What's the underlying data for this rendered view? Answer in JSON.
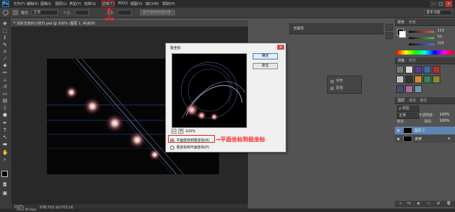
{
  "app": {
    "logo": "Ps"
  },
  "menu": {
    "items": [
      "文件(F)",
      "编辑(E)",
      "图像(I)",
      "图层(L)",
      "类型(Y)",
      "选择(S)",
      "滤镜(T)",
      "3D(D)",
      "视图(V)",
      "窗口(W)",
      "帮助(H)"
    ],
    "highlighted": "滤镜(T)",
    "window_buttons": [
      "–",
      "□",
      "×"
    ]
  },
  "options_bar": {
    "mode_label": "模式:",
    "mode_value": "正常",
    "opacity_label": "不透:",
    "flow_label": "流量:",
    "button_label": "画于使用新建的度",
    "workspace": "基本功能"
  },
  "annotation": {
    "menu_callout": "滤镜",
    "radio_callout": "→平面坐标到极坐标"
  },
  "document": {
    "tab_title": "炫彩光效的小技巧.psd @ 100% (图层 1, RGB/8)",
    "status_text": "文档:703.1K/703.1K",
    "bottom_label": "Mini Bridge"
  },
  "dialog": {
    "title": "极坐标",
    "ok_label": "确定",
    "cancel_label": "复位",
    "zoom_value": "100%",
    "zoom_out": "−",
    "zoom_in": "+",
    "options": [
      {
        "label": "平面坐标到极坐标(R)",
        "selected": true
      },
      {
        "label": "极坐标到平面坐标(P)",
        "selected": false
      }
    ]
  },
  "properties_panel": {
    "title": "无属性",
    "mini_items": [
      "字符",
      "段落"
    ]
  },
  "color_panel": {
    "tabs": [
      "颜色",
      "色板"
    ],
    "values": [
      "115",
      "53",
      "225"
    ],
    "colors": {
      "r": "#e35b5b",
      "g": "#4fc04f",
      "b": "#4a78e0"
    }
  },
  "adjust_panel": {
    "tabs": [
      "调整",
      "样式"
    ]
  },
  "layers_panel": {
    "tabs": [
      "图层",
      "通道",
      "路径"
    ],
    "kind_label": "ρ 类型",
    "blend_mode": "正常",
    "opacity_label": "不透明度:",
    "opacity_value": "100%",
    "lock_label": "锁定:",
    "fill_label": "填充:",
    "fill_value": "100%",
    "layers": [
      {
        "name": "图层 1",
        "selected": true
      },
      {
        "name": "背景",
        "selected": false
      }
    ]
  }
}
